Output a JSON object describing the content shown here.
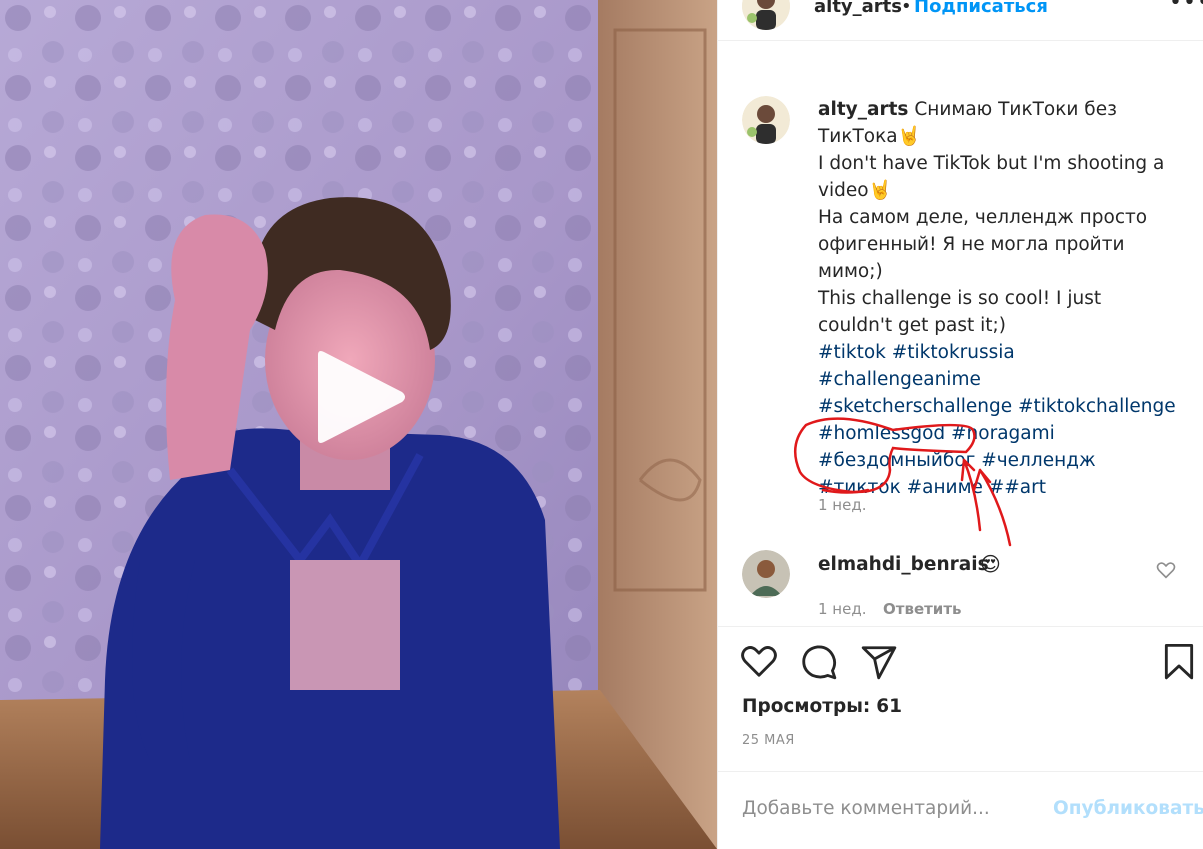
{
  "post": {
    "username": "alty_arts",
    "separator": "•",
    "follow_label": "Подписаться",
    "more_label": "•••"
  },
  "caption": {
    "username": "alty_arts",
    "text": " Снимаю ТикТоки без ТикТока🤘\nI don't have TikTok but I'm shooting a video🤘\nНа самом деле, челлендж просто офигенный! Я не могла пройти мимо;)\nThis challenge is so cool! I just couldn't get past it;)\n",
    "hashtags": "#tiktok #tiktokrussia #challengeanime #sketcherschallenge #tiktokchallenge #homlessgod #noragami #бездомныйбог #челлендж #тикток #аниме ##art",
    "time": "1 нед."
  },
  "comment": {
    "username": "elmahdi_benrais",
    "emoji": "😍",
    "time": "1 нед.",
    "reply_label": "Ответить"
  },
  "stats": {
    "views_label": "Просмотры:",
    "views_count": "61",
    "date": "25 МАЯ"
  },
  "composer": {
    "placeholder": "Добавьте комментарий...",
    "publish_label": "Опубликовать"
  },
  "icons": [
    "play-icon",
    "more-icon",
    "heart-icon",
    "comment-icon",
    "share-icon",
    "bookmark-icon",
    "comment-like-icon"
  ],
  "colors": {
    "link": "#0095f6",
    "hashtag": "#00376b",
    "muted": "#8e8e8e",
    "publish_disabled": "#b2dffc",
    "annotation": "#e0191b"
  }
}
